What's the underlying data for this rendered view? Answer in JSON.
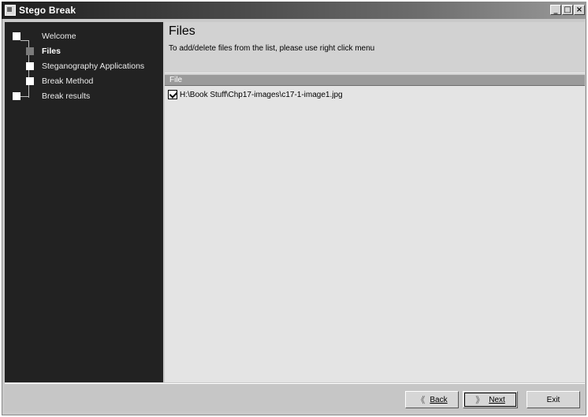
{
  "window": {
    "title": "Stego Break",
    "controls": {
      "minimize": "_",
      "maximize": "□",
      "close": "×"
    }
  },
  "sidebar": {
    "steps": [
      {
        "label": "Welcome",
        "active": false
      },
      {
        "label": "Files",
        "active": true
      },
      {
        "label": "Steganography Applications",
        "active": false
      },
      {
        "label": "Break Method",
        "active": false
      },
      {
        "label": "Break results",
        "active": false
      }
    ]
  },
  "main": {
    "title": "Files",
    "subtitle": "To add/delete files from the list, please use right click menu",
    "list": {
      "column_header": "File",
      "items": [
        {
          "path": "H:\\Book Stuff\\Chp17-images\\c17-1-image1.jpg",
          "checked": true
        }
      ]
    }
  },
  "footer": {
    "back_label": "Back",
    "next_label": "Next",
    "exit_label": "Exit",
    "back_icon": "chevron-left-icon",
    "next_icon": "chevron-right-icon"
  }
}
